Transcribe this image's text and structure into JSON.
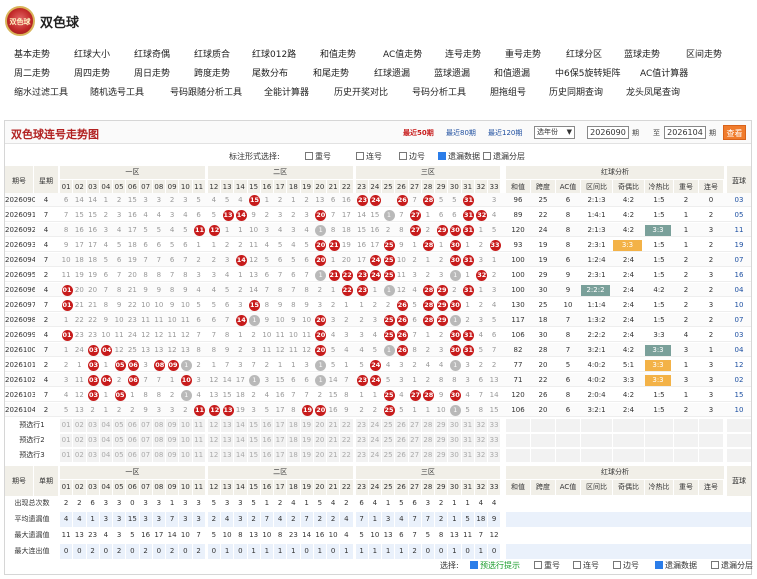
{
  "app": {
    "title": "双色球",
    "logo_text": "双色球"
  },
  "nav": {
    "row1": [
      "基本走势",
      "红球大小",
      "红球奇偶",
      "红球质合",
      "红球012路",
      "和值走势",
      "AC值走势",
      "连号走势",
      "重号走势",
      "红球分区",
      "蓝球走势",
      "区间走势"
    ],
    "row2": [
      "周二走势",
      "周四走势",
      "周日走势",
      "跨度走势",
      "尾数分布",
      "和尾走势",
      "红球遗漏",
      "蓝球遗漏",
      "和值遗漏",
      "中6保5旋转矩阵",
      "AC值计算器"
    ],
    "row3": [
      "缩水过滤工具",
      "随机选号工具",
      "号码跟随分析工具",
      "全能计算器",
      "历史开奖对比",
      "号码分析工具",
      "胆拖组号",
      "历史同期查询",
      "龙头凤尾查询"
    ]
  },
  "panel": {
    "title": "双色球连号走势图",
    "ranges": [
      "最近50期",
      "最近80期",
      "最近120期"
    ],
    "active_range": 0,
    "select_label": "选年份",
    "from_label": "期",
    "to_label": "至",
    "from_period": "2026090",
    "to_period": "2026104",
    "to_suffix": "期",
    "query": "查看",
    "options_label": "标注形式选择:",
    "options": [
      {
        "label": "重号",
        "checked": false
      },
      {
        "label": "连号",
        "checked": false
      },
      {
        "label": "边号",
        "checked": false
      },
      {
        "label": "遗漏数据",
        "checked": true
      },
      {
        "label": "遗漏分层",
        "checked": false
      }
    ]
  },
  "table": {
    "head_period": "期号",
    "head_week": "星期",
    "zones": [
      "一区",
      "二区",
      "三区"
    ],
    "analysis": "红球分析",
    "blue_head": "蓝球",
    "analysis_cols": [
      "和值",
      "跨度",
      "AC值",
      "区间比",
      "奇偶比",
      "冷热比",
      "重号",
      "连号"
    ],
    "rows": [
      {
        "p": "2026090",
        "w": "4",
        "reds": [
          15,
          23,
          24,
          26,
          28,
          31
        ],
        "miss": [
          6,
          14,
          14,
          1,
          2,
          15,
          3,
          3,
          2,
          3,
          5,
          4,
          5,
          4,
          8,
          1,
          2,
          1,
          2,
          13,
          6,
          16,
          13,
          14,
          null,
          null,
          7,
          null,
          5,
          5,
          4,
          null,
          3
        ],
        "a": [
          "96",
          "25",
          "6",
          "2:1:3",
          "4:2",
          "1:5",
          "2",
          "0"
        ],
        "blue": "03"
      },
      {
        "p": "2026091",
        "w": "7",
        "reds": [
          13,
          14,
          20,
          27,
          31,
          32
        ],
        "miss": [
          7,
          15,
          15,
          2,
          3,
          16,
          4,
          4,
          3,
          4,
          6,
          5,
          null,
          null,
          9,
          2,
          3,
          2,
          3,
          null,
          7,
          17,
          14,
          15,
          1,
          7,
          null,
          1,
          6,
          6,
          null,
          null,
          4
        ],
        "a": [
          "89",
          "22",
          "8",
          "1:4:1",
          "4:2",
          "1:5",
          "1",
          "2"
        ],
        "blue": "05"
      },
      {
        "p": "2026092",
        "w": "4",
        "reds": [
          11,
          12,
          27,
          29,
          30,
          31
        ],
        "miss": [
          8,
          16,
          16,
          3,
          4,
          17,
          5,
          5,
          4,
          5,
          null,
          null,
          1,
          1,
          10,
          3,
          4,
          3,
          4,
          1,
          8,
          18,
          15,
          16,
          2,
          8,
          null,
          2,
          null,
          null,
          null,
          1,
          5
        ],
        "a": [
          "120",
          "24",
          "8",
          "2:1:3",
          "4:2",
          "3:3",
          "1",
          "3"
        ],
        "hl": {
          "idx": 5,
          "color": "#7aa09a"
        },
        "blue": "11"
      },
      {
        "p": "2026093",
        "w": "4",
        "reds": [
          20,
          21,
          25,
          28,
          30,
          33
        ],
        "miss": [
          9,
          17,
          17,
          4,
          5,
          18,
          6,
          6,
          5,
          6,
          1,
          1,
          2,
          2,
          11,
          4,
          5,
          4,
          5,
          null,
          null,
          19,
          16,
          17,
          null,
          9,
          1,
          null,
          1,
          2,
          1,
          2,
          null
        ],
        "a": [
          "93",
          "19",
          "8",
          "2:3:1",
          "3:3",
          "1:5",
          "1",
          "2"
        ],
        "hl": {
          "idx": 4,
          "color": "#f3b247"
        },
        "blue": "19"
      },
      {
        "p": "2026094",
        "w": "7",
        "reds": [
          14,
          20,
          24,
          25,
          30,
          31
        ],
        "miss": [
          10,
          18,
          18,
          5,
          6,
          19,
          7,
          7,
          6,
          7,
          2,
          2,
          3,
          null,
          12,
          5,
          6,
          5,
          6,
          null,
          1,
          20,
          17,
          null,
          null,
          10,
          2,
          1,
          2,
          null,
          null,
          3,
          1
        ],
        "a": [
          "100",
          "19",
          "6",
          "1:2:4",
          "2:4",
          "1:5",
          "2",
          "2"
        ],
        "blue": "07"
      },
      {
        "p": "2026095",
        "w": "2",
        "reds": [
          21,
          22,
          23,
          24,
          25,
          32
        ],
        "miss": [
          11,
          19,
          19,
          6,
          7,
          20,
          8,
          8,
          7,
          8,
          3,
          3,
          4,
          1,
          13,
          6,
          7,
          6,
          7,
          1,
          null,
          null,
          null,
          null,
          null,
          11,
          3,
          2,
          3,
          1,
          1,
          null,
          2
        ],
        "a": [
          "100",
          "29",
          "9",
          "2:3:1",
          "2:4",
          "1:5",
          "2",
          "3"
        ],
        "blue": "16"
      },
      {
        "p": "2026096",
        "w": "4",
        "reds": [
          1,
          22,
          23,
          28,
          29,
          31
        ],
        "miss": [
          null,
          20,
          20,
          7,
          8,
          21,
          9,
          9,
          8,
          9,
          4,
          4,
          5,
          2,
          14,
          7,
          8,
          7,
          8,
          2,
          1,
          null,
          null,
          1,
          1,
          12,
          4,
          null,
          null,
          2,
          null,
          1,
          3
        ],
        "a": [
          "100",
          "30",
          "9",
          "2:2:2",
          "2:4",
          "4:2",
          "2",
          "2"
        ],
        "hl": {
          "idx": 3,
          "color": "#7aa09a"
        },
        "blue": "04"
      },
      {
        "p": "2026097",
        "w": "7",
        "reds": [
          1,
          15,
          26,
          28,
          29,
          30
        ],
        "miss": [
          null,
          21,
          21,
          8,
          9,
          22,
          10,
          10,
          9,
          10,
          5,
          5,
          6,
          3,
          null,
          8,
          9,
          8,
          9,
          3,
          2,
          1,
          1,
          2,
          2,
          null,
          5,
          null,
          null,
          null,
          1,
          2,
          4
        ],
        "a": [
          "130",
          "25",
          "10",
          "1:1:4",
          "2:4",
          "1:5",
          "2",
          "3"
        ],
        "blue": "10"
      },
      {
        "p": "2026098",
        "w": "2",
        "reds": [
          14,
          20,
          25,
          26,
          28,
          29
        ],
        "miss": [
          1,
          22,
          22,
          9,
          10,
          23,
          11,
          11,
          10,
          11,
          6,
          6,
          7,
          null,
          1,
          9,
          10,
          9,
          10,
          null,
          3,
          2,
          2,
          3,
          null,
          null,
          6,
          null,
          1,
          1,
          2,
          3,
          5
        ],
        "a": [
          "117",
          "18",
          "7",
          "1:3:2",
          "2:4",
          "1:5",
          "2",
          "2"
        ],
        "blue": "07"
      },
      {
        "p": "2026099",
        "w": "4",
        "reds": [
          1,
          20,
          25,
          26,
          30,
          31
        ],
        "miss": [
          null,
          23,
          23,
          10,
          11,
          24,
          12,
          12,
          11,
          12,
          7,
          7,
          8,
          1,
          2,
          10,
          11,
          10,
          11,
          null,
          4,
          3,
          3,
          4,
          null,
          null,
          7,
          1,
          2,
          null,
          null,
          4,
          6
        ],
        "a": [
          "106",
          "30",
          "8",
          "2:2:2",
          "2:4",
          "3:3",
          "4",
          "2"
        ],
        "blue": "03"
      },
      {
        "p": "2026100",
        "w": "7",
        "reds": [
          3,
          4,
          20,
          26,
          30,
          31
        ],
        "miss": [
          1,
          24,
          null,
          null,
          12,
          25,
          13,
          13,
          12,
          13,
          8,
          8,
          9,
          2,
          3,
          11,
          12,
          11,
          12,
          null,
          5,
          4,
          4,
          5,
          1,
          null,
          8,
          2,
          3,
          null,
          null,
          5,
          7
        ],
        "a": [
          "82",
          "28",
          "7",
          "3:2:1",
          "4:2",
          "3:3",
          "3",
          "1"
        ],
        "hl": {
          "idx": 5,
          "color": "#7aa09a"
        },
        "blue": "04"
      },
      {
        "p": "2026101",
        "w": "2",
        "reds": [
          3,
          5,
          6,
          8,
          9,
          24
        ],
        "miss": [
          2,
          1,
          null,
          1,
          null,
          null,
          3,
          null,
          null,
          1,
          2,
          1,
          7,
          3,
          7,
          2,
          1,
          1,
          3,
          1,
          5,
          1,
          5,
          null,
          4,
          3,
          2,
          4,
          4,
          1,
          3,
          2,
          2
        ],
        "a": [
          "77",
          "20",
          "5",
          "4:0:2",
          "5:1",
          "3:3",
          "1",
          "3"
        ],
        "hl": {
          "idx": 5,
          "color": "#f3b247"
        },
        "blue": "12"
      },
      {
        "p": "2026102",
        "w": "4",
        "reds": [
          3,
          4,
          6,
          10,
          23,
          24
        ],
        "miss": [
          3,
          11,
          null,
          null,
          2,
          null,
          7,
          7,
          1,
          null,
          3,
          12,
          14,
          17,
          1,
          3,
          15,
          6,
          6,
          1,
          14,
          7,
          null,
          null,
          5,
          3,
          1,
          2,
          8,
          8,
          3,
          6,
          13
        ],
        "a": [
          "71",
          "22",
          "6",
          "4:0:2",
          "3:3",
          "3:3",
          "3",
          "3"
        ],
        "hl": {
          "idx": 5,
          "color": "#f3b247"
        },
        "blue": "02"
      },
      {
        "p": "2026103",
        "w": "7",
        "reds": [
          3,
          5,
          25,
          27,
          28,
          30
        ],
        "miss": [
          4,
          12,
          null,
          1,
          null,
          1,
          8,
          8,
          2,
          1,
          4,
          13,
          15,
          18,
          2,
          4,
          16,
          7,
          7,
          2,
          15,
          8,
          1,
          1,
          null,
          4,
          null,
          null,
          9,
          null,
          4,
          7,
          14
        ],
        "a": [
          "120",
          "26",
          "8",
          "2:0:4",
          "4:2",
          "1:5",
          "1",
          "3"
        ],
        "blue": "15"
      },
      {
        "p": "2026104",
        "w": "2",
        "reds": [
          11,
          12,
          13,
          19,
          20,
          25
        ],
        "miss": [
          5,
          13,
          2,
          1,
          2,
          2,
          9,
          3,
          3,
          2,
          null,
          null,
          null,
          19,
          3,
          5,
          17,
          8,
          null,
          null,
          16,
          9,
          2,
          2,
          null,
          5,
          1,
          1,
          10,
          1,
          5,
          8,
          15
        ],
        "a": [
          "106",
          "20",
          "6",
          "3:2:1",
          "2:4",
          "1:5",
          "2",
          "3"
        ],
        "blue": "10"
      }
    ],
    "presel": [
      "预选行1",
      "预选行2",
      "预选行3"
    ],
    "stats": [
      {
        "label": "出现总次数",
        "v": [
          2,
          2,
          6,
          3,
          3,
          0,
          3,
          3,
          1,
          3,
          3,
          5,
          3,
          3,
          5,
          1,
          2,
          4,
          1,
          5,
          4,
          2,
          6,
          4,
          1,
          5,
          6,
          3,
          2,
          1,
          1,
          4,
          4,
          0,
          2
        ]
      },
      {
        "label": "平均遗漏值",
        "v": [
          4,
          4,
          1,
          3,
          3,
          15,
          3,
          3,
          7,
          3,
          3,
          2,
          4,
          3,
          2,
          7,
          4,
          2,
          7,
          2,
          2,
          4,
          7,
          1,
          3,
          4,
          7,
          7,
          2,
          1,
          5,
          18,
          9
        ]
      },
      {
        "label": "最大遗漏值",
        "v": [
          11,
          13,
          23,
          4,
          3,
          5,
          16,
          17,
          14,
          10,
          7,
          5,
          10,
          8,
          13,
          10,
          8,
          23,
          14,
          16,
          10,
          4,
          5,
          10,
          13,
          6,
          7,
          5,
          8,
          13,
          11,
          7,
          12
        ]
      },
      {
        "label": "最大连出值",
        "v": [
          0,
          0,
          2,
          0,
          2,
          0,
          2,
          0,
          2,
          0,
          2,
          0,
          1,
          0,
          1,
          1,
          1,
          1,
          0,
          1,
          0,
          1,
          1,
          1,
          1,
          1,
          2,
          0,
          0,
          1,
          0,
          1,
          0
        ]
      }
    ],
    "stat_head_period": "期号",
    "stat_head_single": "单期",
    "footer": {
      "label": "选择:",
      "options": [
        {
          "label": "预选行提示",
          "checked": true
        },
        {
          "label": "重号",
          "checked": false
        },
        {
          "label": "连号",
          "checked": false
        },
        {
          "label": "边号",
          "checked": false
        },
        {
          "label": "遗漏数据",
          "checked": true
        },
        {
          "label": "遗漏分层",
          "checked": false
        }
      ]
    }
  }
}
